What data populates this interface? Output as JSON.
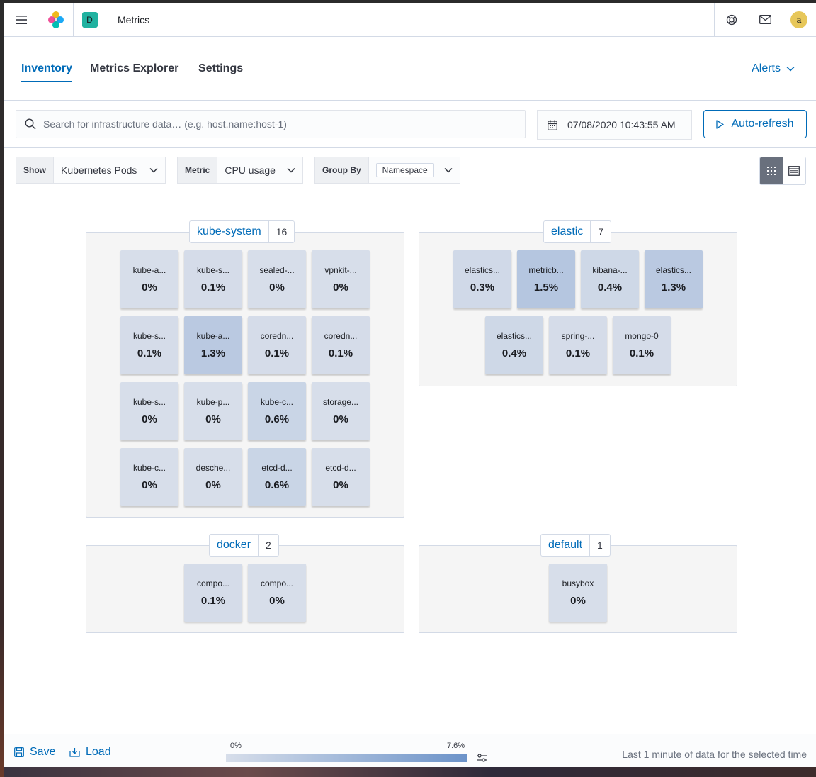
{
  "header": {
    "space_initial": "D",
    "title": "Metrics",
    "avatar_initial": "a"
  },
  "tabs": [
    {
      "label": "Inventory",
      "active": true
    },
    {
      "label": "Metrics Explorer",
      "active": false
    },
    {
      "label": "Settings",
      "active": false
    }
  ],
  "alerts_label": "Alerts",
  "search": {
    "placeholder": "Search for infrastructure data… (e.g. host.name:host-1)",
    "value": ""
  },
  "date": "07/08/2020 10:43:55 AM",
  "auto_refresh_label": "Auto-refresh",
  "filters": {
    "show": {
      "label": "Show",
      "value": "Kubernetes Pods"
    },
    "metric": {
      "label": "Metric",
      "value": "CPU usage"
    },
    "group_by": {
      "label": "Group By",
      "value": "Namespace"
    }
  },
  "groups": [
    {
      "name": "kube-system",
      "count": "16",
      "nodes": [
        {
          "name": "kube-a...",
          "value": "0%"
        },
        {
          "name": "kube-s...",
          "value": "0.1%"
        },
        {
          "name": "sealed-...",
          "value": "0%"
        },
        {
          "name": "vpnkit-...",
          "value": "0%"
        },
        {
          "name": "kube-s...",
          "value": "0.1%"
        },
        {
          "name": "kube-a...",
          "value": "1.3%"
        },
        {
          "name": "coredn...",
          "value": "0.1%"
        },
        {
          "name": "coredn...",
          "value": "0.1%"
        },
        {
          "name": "kube-s...",
          "value": "0%"
        },
        {
          "name": "kube-p...",
          "value": "0%"
        },
        {
          "name": "kube-c...",
          "value": "0.6%"
        },
        {
          "name": "storage...",
          "value": "0%"
        },
        {
          "name": "kube-c...",
          "value": "0%"
        },
        {
          "name": "desche...",
          "value": "0%"
        },
        {
          "name": "etcd-d...",
          "value": "0.6%"
        },
        {
          "name": "etcd-d...",
          "value": "0%"
        }
      ]
    },
    {
      "name": "elastic",
      "count": "7",
      "nodes": [
        {
          "name": "elastics...",
          "value": "0.3%"
        },
        {
          "name": "metricb...",
          "value": "1.5%"
        },
        {
          "name": "kibana-...",
          "value": "0.4%"
        },
        {
          "name": "elastics...",
          "value": "1.3%"
        },
        {
          "name": "elastics...",
          "value": "0.4%"
        },
        {
          "name": "spring-...",
          "value": "0.1%"
        },
        {
          "name": "mongo-0",
          "value": "0.1%"
        }
      ]
    },
    {
      "name": "docker",
      "count": "2",
      "nodes": [
        {
          "name": "compo...",
          "value": "0.1%"
        },
        {
          "name": "compo...",
          "value": "0%"
        }
      ]
    },
    {
      "name": "default",
      "count": "1",
      "nodes": [
        {
          "name": "busybox",
          "value": "0%"
        }
      ]
    }
  ],
  "footer": {
    "save_label": "Save",
    "load_label": "Load",
    "legend_min": "0%",
    "legend_max": "7.6%",
    "note": "Last 1 minute of data for the selected time"
  },
  "colors": {
    "accent": "#006bb8",
    "legend_low": "#d7deea",
    "legend_high": "#6c93c9"
  }
}
